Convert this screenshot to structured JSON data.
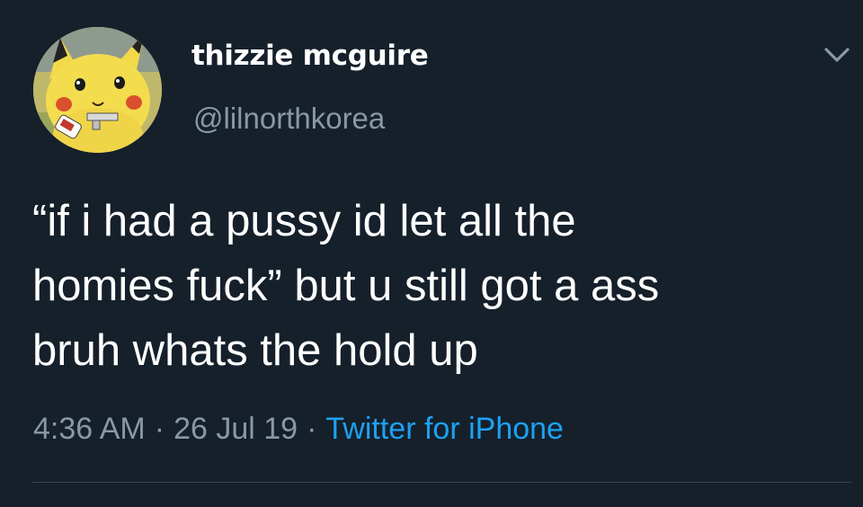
{
  "tweet": {
    "display_name": "thizzie mcguire",
    "handle": "@lilnorthkorea",
    "avatar_icon": "pikachu-avatar",
    "menu_icon": "chevron-down-icon",
    "text_lines": [
      "“if i had a pussy id let all the",
      "homies fuck” but u still got a ass",
      "bruh whats the hold up"
    ],
    "time": "4:36 AM",
    "separator": "·",
    "date": "26 Jul 19",
    "source": "Twitter for iPhone"
  },
  "colors": {
    "background": "#15202b",
    "text": "#ffffff",
    "secondary_text": "#8899a6",
    "link": "#1da1f2",
    "divider": "#38444d"
  }
}
